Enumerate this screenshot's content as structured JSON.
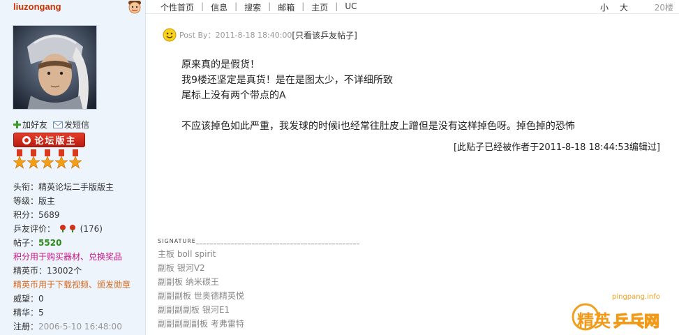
{
  "user": {
    "name": "liuzongang",
    "add_friend": "加好友",
    "send_message": "发短信",
    "badge": "论坛版主",
    "medal_count": 5,
    "info": {
      "title_label": "头衔：",
      "title_value": "精英论坛二手版版主",
      "level_label": "等级：",
      "level_value": "版主",
      "points_label": "积分：",
      "points_value": "5689",
      "rating_label": "乒友评价：",
      "rating_value": "(176)",
      "posts_label": "帖子：",
      "posts_value": "5520",
      "points_note": "积分用于购买器材、兑换奖品",
      "coins_label": "精英币：",
      "coins_value": "13002个",
      "coins_note": "精英币用于下载视频、颁发勋章",
      "prestige_label": "威望：",
      "prestige_value": "0",
      "essence_label": "精华：",
      "essence_value": "5",
      "register_label": "注册：",
      "register_value": "2006-5-10 16:48:00"
    }
  },
  "nav": {
    "links": [
      "个性首页",
      "信息",
      "搜索",
      "邮箱",
      "主页",
      "UC"
    ],
    "font_small": "小",
    "font_large": "大",
    "floor": "20楼"
  },
  "post": {
    "meta": "Post By：2011-8-18 18:40:00",
    "only_author": "[只看该乒友帖子]",
    "lines": [
      "原来真的是假货！",
      "我9楼还坚定是真货！是在是图太少，不详细所致",
      "尾标上没有两个带点的A",
      "",
      "不应该掉色如此严重，我发球的时候i也经常往肚皮上蹭但是没有这样掉色呀。掉色掉的恐怖"
    ],
    "edited": "[此贴子已经被作者于2011-8-18 18:44:53编辑过]"
  },
  "signature": {
    "header": "SIGNATURE_______________________________________________",
    "lines": [
      "主板  boll spirit",
      "副板  银河V2",
      "副副板  纳米碳王",
      "副副副板  世奥德精英悦",
      "副副副副板  银河E1",
      "副副副副副板  考弗雷特"
    ]
  },
  "watermark": {
    "url": "pingpang.info",
    "brand_a": "精英",
    "brand_b": "乒乓网"
  },
  "colors": {
    "username": "#cc3300",
    "sidebar_bg": "#eef4fb",
    "badge_red": "#d02a1a",
    "pink_note": "#c71585",
    "orange_note": "#d2691e",
    "posts_green": "#2a8a16"
  }
}
